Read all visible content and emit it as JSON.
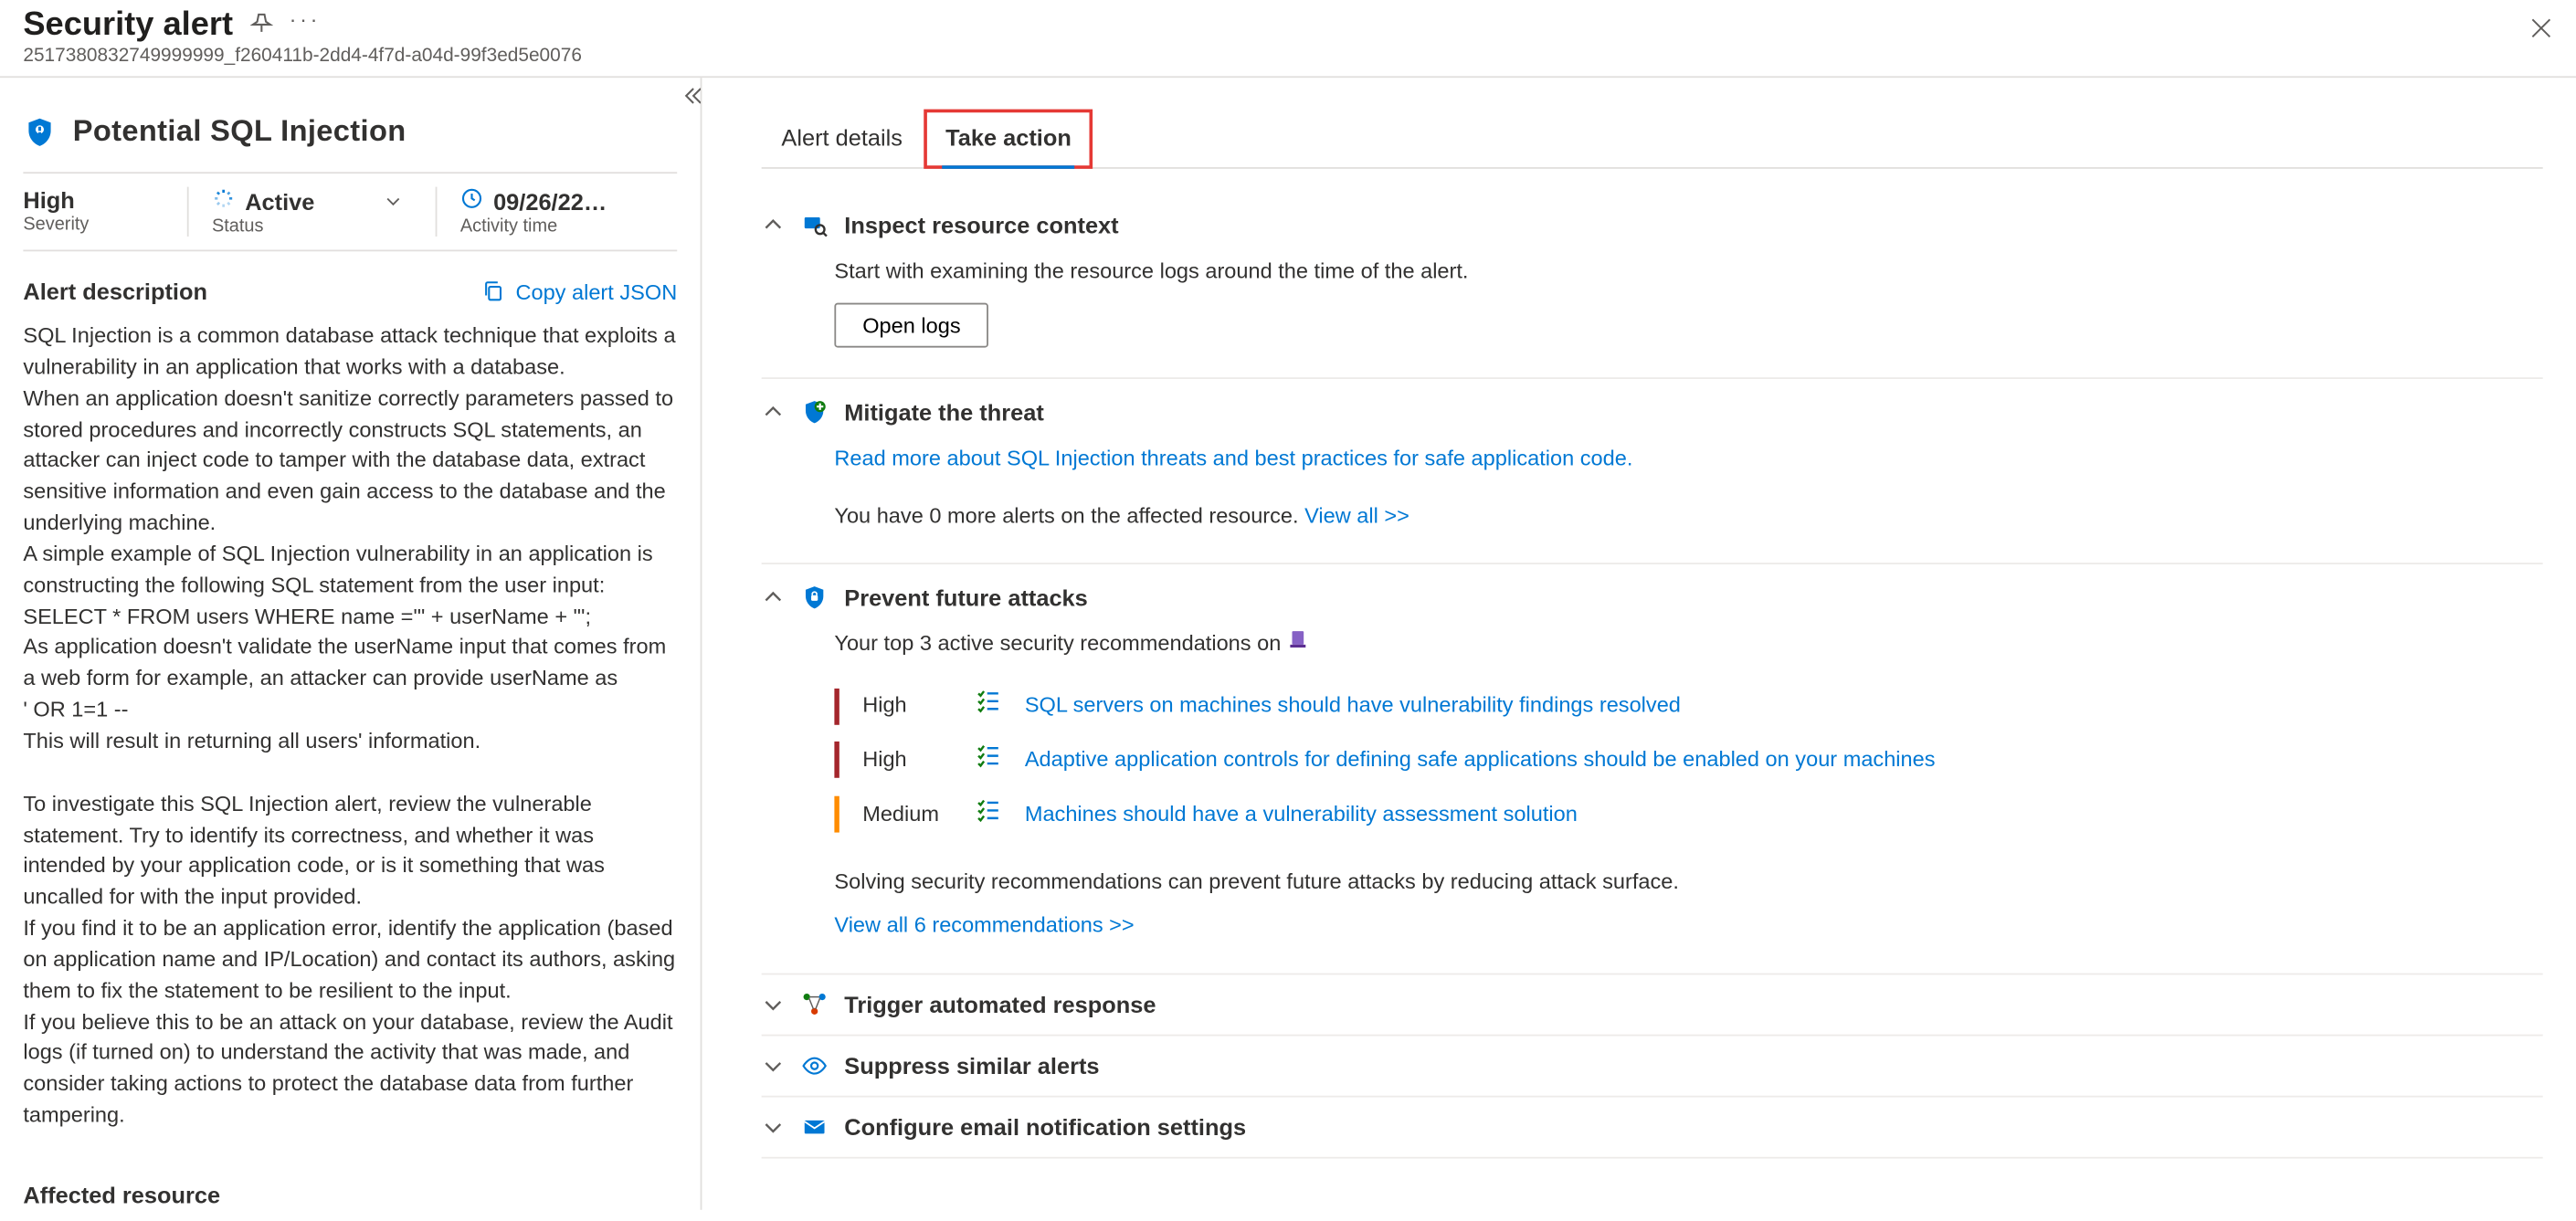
{
  "header": {
    "title": "Security alert",
    "sub_id": "2517380832749999999_f260411b-2dd4-4f7d-a04d-99f3ed5e0076"
  },
  "left": {
    "alert_name": "Potential SQL Injection",
    "severity": {
      "value": "High",
      "label": "Severity"
    },
    "status": {
      "value": "Active",
      "label": "Status"
    },
    "activity": {
      "value": "09/26/22…",
      "label": "Activity time"
    },
    "desc_heading": "Alert description",
    "copy_json": "Copy alert JSON",
    "description": "SQL Injection is a common database attack technique that exploits a vulnerability in an application that works with a database.\nWhen an application doesn't sanitize correctly parameters passed to stored procedures and incorrectly constructs SQL statements, an attacker can inject code to tamper with the database data, extract sensitive information and even gain access to the database and the underlying machine.\nA simple example of SQL Injection vulnerability in an application is constructing the following SQL statement from the user input:\nSELECT * FROM users WHERE name ='\" + userName + \"';\nAs application doesn't validate the userName input that comes from a web form for example, an attacker can provide userName as\n' OR 1=1 --\nThis will result in returning all users' information.\n\nTo investigate this SQL Injection alert, review the vulnerable statement. Try to identify its correctness, and whether it was intended by your application code, or is it something that was uncalled for with the input provided.\nIf you find it to be an application error, identify the application (based on application name and IP/Location) and contact its authors, asking them to fix the statement to be resilient to the input.\nIf you believe this to be an attack on your database, review the Audit logs (if turned on) to understand the activity that was made, and consider taking actions to protect the database data from further tampering.",
    "affected_heading": "Affected resource"
  },
  "tabs": {
    "details": "Alert details",
    "action": "Take action"
  },
  "actions": {
    "inspect": {
      "title": "Inspect resource context",
      "text": "Start with examining the resource logs around the time of the alert.",
      "button": "Open logs"
    },
    "mitigate": {
      "title": "Mitigate the threat",
      "link": "Read more about SQL Injection threats and best practices for safe application code.",
      "text_before": "You have 0 more alerts on the affected resource. ",
      "viewall": "View all >>"
    },
    "prevent": {
      "title": "Prevent future attacks",
      "intro": "Your top 3 active security recommendations on ",
      "recs": [
        {
          "sev": "High",
          "link": "SQL servers on machines should have vulnerability findings resolved"
        },
        {
          "sev": "High",
          "link": "Adaptive application controls for defining safe applications should be enabled on your machines"
        },
        {
          "sev": "Medium",
          "link": "Machines should have a vulnerability assessment solution"
        }
      ],
      "footer_text": "Solving security recommendations can prevent future attacks by reducing attack surface.",
      "viewall": "View all 6 recommendations >>"
    },
    "trigger": {
      "title": "Trigger automated response"
    },
    "suppress": {
      "title": "Suppress similar alerts"
    },
    "email": {
      "title": "Configure email notification settings"
    }
  }
}
